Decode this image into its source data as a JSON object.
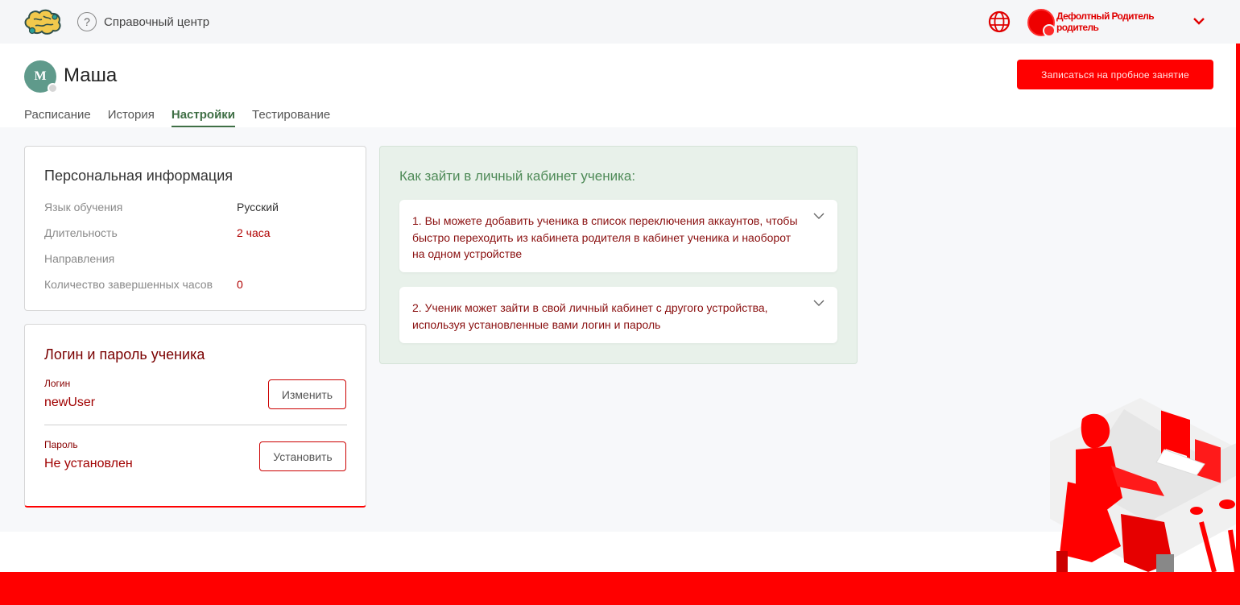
{
  "topbar": {
    "help_label": "Справочный центр",
    "help_glyph": "?",
    "account_role": "Дефолтный Родитель родитель"
  },
  "header": {
    "avatar_initial": "М",
    "student_name": "Маша",
    "trial_button": "Записаться на пробное занятие"
  },
  "tabs": [
    {
      "label": "Расписание",
      "active": false
    },
    {
      "label": "История",
      "active": false
    },
    {
      "label": "Настройки",
      "active": true
    },
    {
      "label": "Тестирование",
      "active": false
    }
  ],
  "personal": {
    "title": "Персональная информация",
    "rows": [
      {
        "label": "Язык обучения",
        "value": "Русский"
      },
      {
        "label": "Длительность",
        "value": "2 часа"
      },
      {
        "label": "Направления",
        "value": ""
      },
      {
        "label": "Количество завершенных часов",
        "value": "0"
      }
    ]
  },
  "login": {
    "title": "Логин и пароль ученика",
    "login_caption": "Логин",
    "login_value": "newUser",
    "change_button": "Изменить",
    "password_caption": "Пароль",
    "password_value": "Не установлен",
    "set_button": "Установить"
  },
  "help": {
    "title": "Как зайти в личный кабинет ученика:",
    "items": [
      {
        "text": "1. Вы можете добавить ученика в список переключения аккаунтов, чтобы быстро переходить из кабинета родителя в кабинет ученика и наоборот на одном устройстве"
      },
      {
        "text": "2. Ученик может зайти в свой личный кабинет с другого устройства, используя установленные вами логин и пароль"
      }
    ]
  },
  "icons": {
    "logo": "brain-logo-icon",
    "help": "question-circle-icon",
    "language": "globe-icon",
    "account_chevron": "chevron-down-icon",
    "faq_chevron": "chevron-down-icon"
  },
  "colors": {
    "accent_green": "#3f6f45",
    "help_bg": "#e8f1ea",
    "brand_red": "#ff0000",
    "avatar": "#5f9a8b"
  }
}
